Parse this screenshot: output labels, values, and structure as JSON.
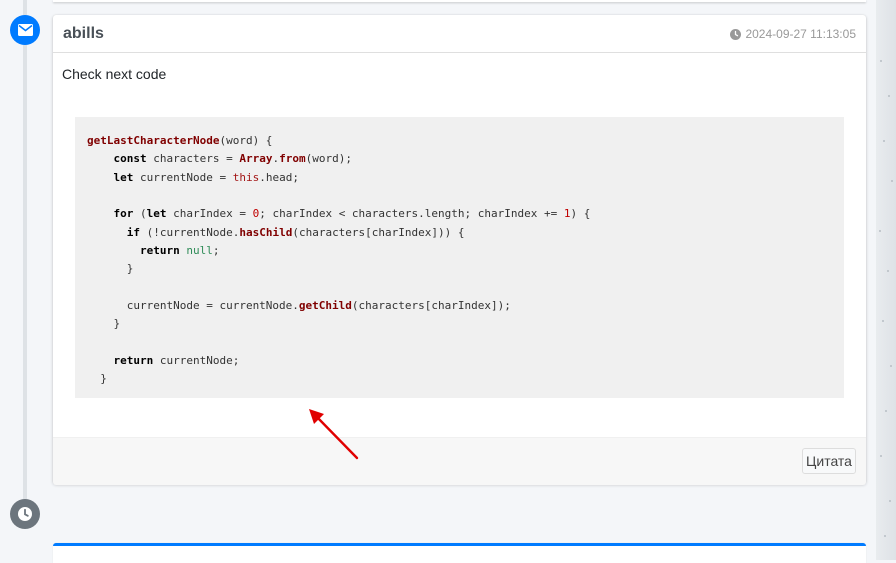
{
  "post": {
    "author": "abills",
    "timestamp": "2024-09-27 11:13:05",
    "message": "Check next code",
    "quote_button": "Цитата"
  },
  "code_lines": [
    [
      [
        "getLastCharacterNode",
        "fn"
      ],
      [
        "(word) {",
        ""
      ]
    ],
    [
      [
        "    ",
        ""
      ],
      [
        "const",
        "b"
      ],
      [
        " characters = ",
        ""
      ],
      [
        "Array",
        "fn"
      ],
      [
        ".",
        ""
      ],
      [
        "from",
        "fn"
      ],
      [
        "(word);",
        ""
      ]
    ],
    [
      [
        "    ",
        ""
      ],
      [
        "let",
        "b"
      ],
      [
        " currentNode = ",
        ""
      ],
      [
        "this",
        "this"
      ],
      [
        ".head;",
        ""
      ]
    ],
    [
      [
        "",
        ""
      ]
    ],
    [
      [
        "    ",
        ""
      ],
      [
        "for",
        "b"
      ],
      [
        " (",
        ""
      ],
      [
        "let",
        "b"
      ],
      [
        " charIndex = ",
        ""
      ],
      [
        "0",
        "num"
      ],
      [
        "; charIndex < characters.length; charIndex += ",
        ""
      ],
      [
        "1",
        "num"
      ],
      [
        ") {",
        ""
      ]
    ],
    [
      [
        "      ",
        ""
      ],
      [
        "if",
        "b"
      ],
      [
        " (!currentNode.",
        ""
      ],
      [
        "hasChild",
        "fn"
      ],
      [
        "(characters[charIndex])) {",
        ""
      ]
    ],
    [
      [
        "        ",
        ""
      ],
      [
        "return",
        "b"
      ],
      [
        " ",
        ""
      ],
      [
        "null",
        "lit"
      ],
      [
        ";",
        ""
      ]
    ],
    [
      [
        "      }",
        ""
      ]
    ],
    [
      [
        "",
        ""
      ]
    ],
    [
      [
        "      currentNode = currentNode.",
        ""
      ],
      [
        "getChild",
        "fn"
      ],
      [
        "(characters[charIndex]);",
        ""
      ]
    ],
    [
      [
        "    }",
        ""
      ]
    ],
    [
      [
        "",
        ""
      ]
    ],
    [
      [
        "    ",
        ""
      ],
      [
        "return",
        "b"
      ],
      [
        " currentNode;",
        ""
      ]
    ],
    [
      [
        "  }",
        ""
      ]
    ]
  ],
  "colors": {
    "accent": "#007bff",
    "timeline_gray": "#6c757d",
    "annotation_arrow": "#e00000"
  },
  "icons": {
    "timeline_top": "envelope-icon",
    "timeline_bottom": "clock-icon",
    "timestamp": "clock-icon"
  }
}
